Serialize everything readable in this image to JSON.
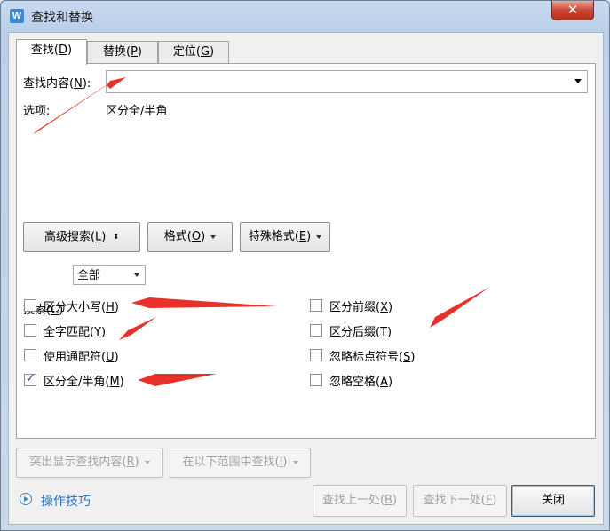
{
  "window": {
    "title": "查找和替换",
    "app_icon": "W",
    "close_symbol": "✕"
  },
  "tabs": [
    {
      "label": "查找(",
      "key": "D",
      "close": ")",
      "active": true
    },
    {
      "label": "替换(",
      "key": "P",
      "close": ")",
      "active": false
    },
    {
      "label": "定位(",
      "key": "G",
      "close": ")",
      "active": false
    }
  ],
  "find": {
    "label": "查找内容(",
    "key": "N",
    "close": "):",
    "value": "",
    "options_label": "选项:",
    "options_value": "区分全/半角"
  },
  "buttons": {
    "advanced": {
      "label": "高级搜索(",
      "key": "L",
      "close": ")",
      "icon": "⬍"
    },
    "format": {
      "label": "格式(",
      "key": "O",
      "close": ")"
    },
    "special": {
      "label": "特殊格式(",
      "key": "E",
      "close": ")"
    }
  },
  "search": {
    "label": "搜索(",
    "key": "C",
    "close": ")",
    "value": "全部"
  },
  "checkboxes": [
    {
      "label": "区分大小写(",
      "key": "H",
      "close": ")",
      "checked": false
    },
    {
      "label": "全字匹配(",
      "key": "Y",
      "close": ")",
      "checked": false
    },
    {
      "label": "使用通配符(",
      "key": "U",
      "close": ")",
      "checked": false
    },
    {
      "label": "区分全/半角(",
      "key": "M",
      "close": ")",
      "checked": true
    },
    {
      "label": "区分前缀(",
      "key": "X",
      "close": ")",
      "checked": false
    },
    {
      "label": "区分后缀(",
      "key": "T",
      "close": ")",
      "checked": false
    },
    {
      "label": "忽略标点符号(",
      "key": "S",
      "close": ")",
      "checked": false
    },
    {
      "label": "忽略空格(",
      "key": "A",
      "close": ")",
      "checked": false
    }
  ],
  "bottom": {
    "highlight": {
      "label": "突出显示查找内容(",
      "key": "R",
      "close": ")"
    },
    "find_in": {
      "label": "在以下范围中查找(",
      "key": "I",
      "close": ")"
    },
    "tips": "操作技巧",
    "prev": {
      "label": "查找上一处(",
      "key": "B",
      "close": ")"
    },
    "next": {
      "label": "查找下一处(",
      "key": "F",
      "close": ")"
    },
    "close": "关闭"
  },
  "colors": {
    "arrow": "#e8312a",
    "link": "#2c6fc4",
    "checkmark": "#1c3f8f"
  }
}
